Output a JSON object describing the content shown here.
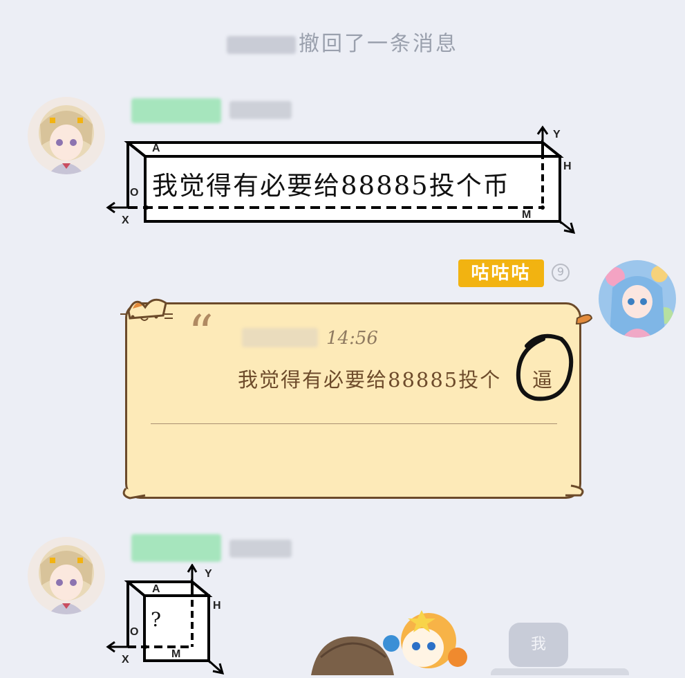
{
  "system_notice": {
    "recalled_text": "撤回了一条消息"
  },
  "messages": [
    {
      "sender_name": "",
      "sender_time": "",
      "text": "我觉得有必要给88885投个币",
      "diagram_labels": {
        "A": "A",
        "O": "O",
        "X": "X",
        "Y": "Y",
        "H": "H",
        "M": "M"
      }
    },
    {
      "sender_badge": "咕咕咕",
      "level": "9",
      "quote": {
        "mark": "“",
        "time": "14:56",
        "text": "我觉得有必要给88885投个",
        "circled_char": "逼"
      }
    },
    {
      "sender_name": "",
      "sender_time": "",
      "text": "?",
      "diagram_labels": {
        "A": "A",
        "O": "O",
        "X": "X",
        "Y": "Y",
        "H": "H",
        "M": "M"
      }
    },
    {
      "text": "我"
    }
  ]
}
